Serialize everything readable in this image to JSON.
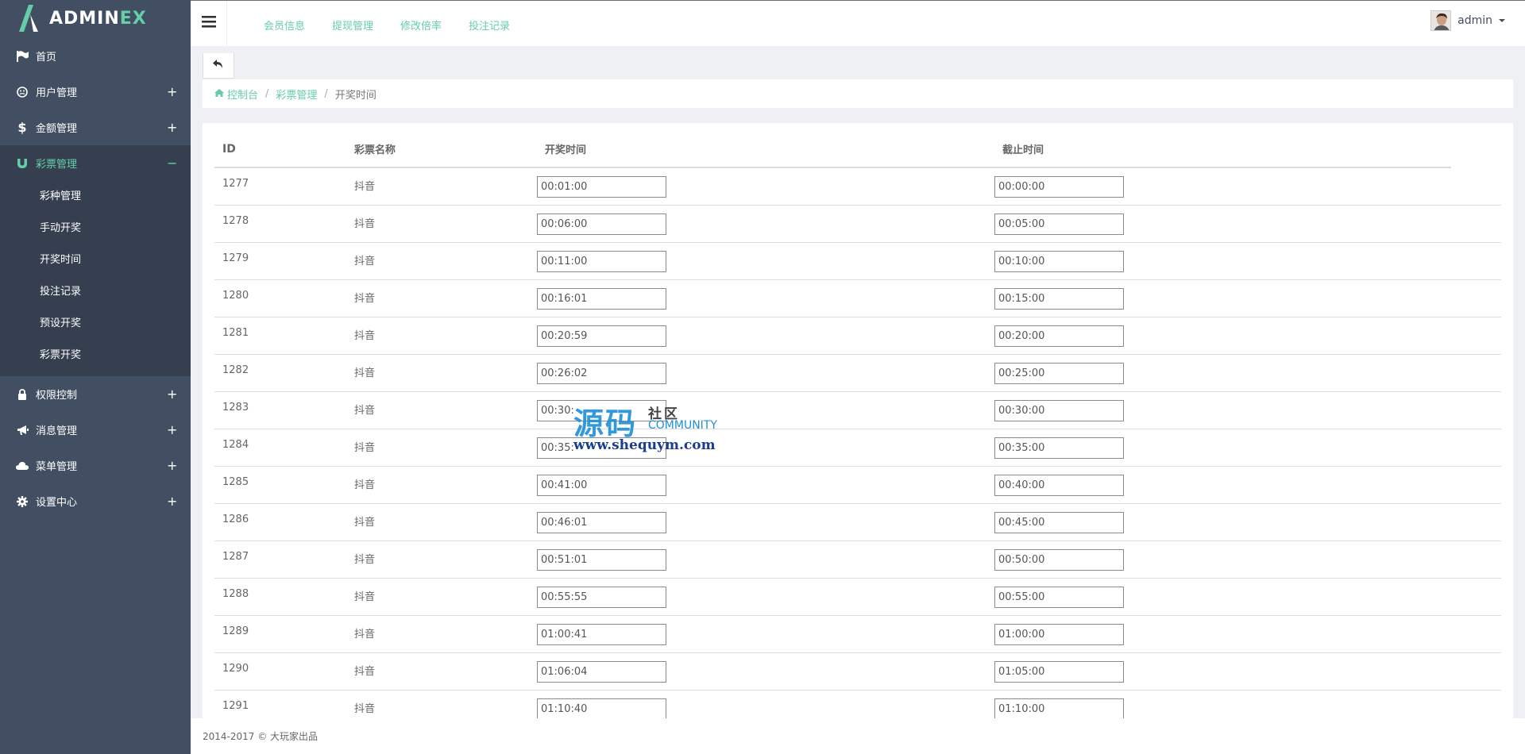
{
  "brand": {
    "name_main": "ADMIN",
    "name_accent": "EX"
  },
  "sidebar": {
    "items": [
      {
        "label": "首页",
        "icon": "flag-icon",
        "toggle": ""
      },
      {
        "label": "用户管理",
        "icon": "user-circle-icon",
        "toggle": "+"
      },
      {
        "label": "金额管理",
        "icon": "dollar-icon",
        "toggle": "+"
      },
      {
        "label": "彩票管理",
        "icon": "magnet-icon",
        "toggle": "−"
      },
      {
        "label": "权限控制",
        "icon": "lock-icon",
        "toggle": "+"
      },
      {
        "label": "消息管理",
        "icon": "bullhorn-icon",
        "toggle": "+"
      },
      {
        "label": "菜单管理",
        "icon": "cloud-icon",
        "toggle": "+"
      },
      {
        "label": "设置中心",
        "icon": "gear-icon",
        "toggle": "+"
      }
    ],
    "subitems": [
      "彩种管理",
      "手动开奖",
      "开奖时间",
      "投注记录",
      "预设开奖",
      "彩票开奖"
    ]
  },
  "header": {
    "links": [
      "会员信息",
      "提现管理",
      "修改倍率",
      "投注记录"
    ],
    "user": "admin"
  },
  "breadcrumb": {
    "home": "控制台",
    "parent": "彩票管理",
    "current": "开奖时间"
  },
  "table": {
    "headers": [
      "ID",
      "彩票名称",
      "开奖时间",
      "截止时间"
    ],
    "rows": [
      {
        "id": "1277",
        "name": "抖音",
        "open": "00:01:00",
        "close": "00:00:00"
      },
      {
        "id": "1278",
        "name": "抖音",
        "open": "00:06:00",
        "close": "00:05:00"
      },
      {
        "id": "1279",
        "name": "抖音",
        "open": "00:11:00",
        "close": "00:10:00"
      },
      {
        "id": "1280",
        "name": "抖音",
        "open": "00:16:01",
        "close": "00:15:00"
      },
      {
        "id": "1281",
        "name": "抖音",
        "open": "00:20:59",
        "close": "00:20:00"
      },
      {
        "id": "1282",
        "name": "抖音",
        "open": "00:26:02",
        "close": "00:25:00"
      },
      {
        "id": "1283",
        "name": "抖音",
        "open": "00:30:",
        "close": "00:30:00"
      },
      {
        "id": "1284",
        "name": "抖音",
        "open": "00:35:",
        "close": "00:35:00"
      },
      {
        "id": "1285",
        "name": "抖音",
        "open": "00:41:00",
        "close": "00:40:00"
      },
      {
        "id": "1286",
        "name": "抖音",
        "open": "00:46:01",
        "close": "00:45:00"
      },
      {
        "id": "1287",
        "name": "抖音",
        "open": "00:51:01",
        "close": "00:50:00"
      },
      {
        "id": "1288",
        "name": "抖音",
        "open": "00:55:55",
        "close": "00:55:00"
      },
      {
        "id": "1289",
        "name": "抖音",
        "open": "01:00:41",
        "close": "01:00:00"
      },
      {
        "id": "1290",
        "name": "抖音",
        "open": "01:06:04",
        "close": "01:05:00"
      },
      {
        "id": "1291",
        "name": "抖音",
        "open": "01:10:40",
        "close": "01:10:00"
      }
    ]
  },
  "footer": {
    "text": "2014-2017 © 大玩家出品"
  },
  "watermark": {
    "big": "源码",
    "small1": "社区",
    "small2": "COMMUNITY",
    "url": "www.shequym.com"
  },
  "colors": {
    "sidebar_bg": "#424f63",
    "sidebar_active": "#353f4f",
    "accent": "#65cea7"
  }
}
